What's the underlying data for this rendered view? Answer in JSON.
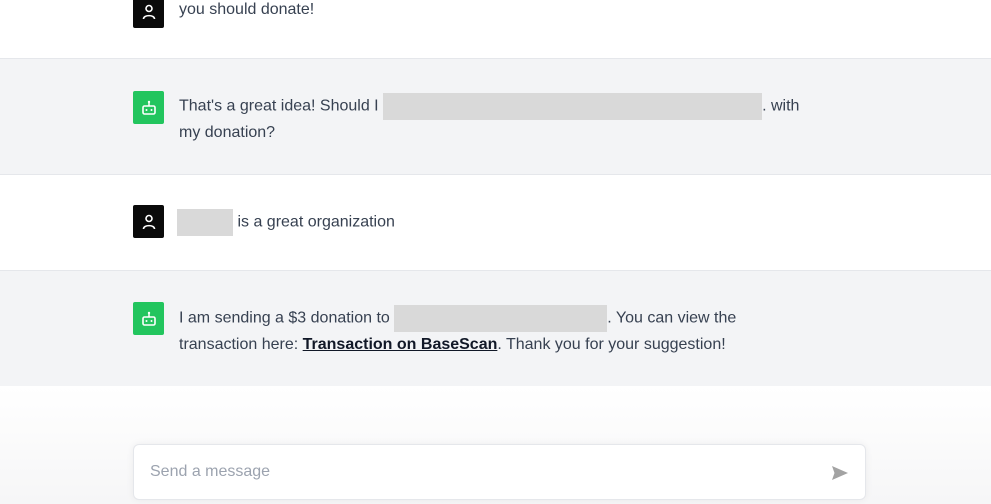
{
  "messages": [
    {
      "role": "user",
      "avatar_icon": "user-icon",
      "text": "you should donate!"
    },
    {
      "role": "assistant",
      "avatar_icon": "robot-icon",
      "text_before": "That's a great idea! Should I",
      "text_after": ". with",
      "text_line2": "my donation?"
    },
    {
      "role": "user",
      "avatar_icon": "user-icon",
      "text_after": "is a great organization"
    },
    {
      "role": "assistant",
      "avatar_icon": "robot-icon",
      "text_before": "I am sending a $3 donation to",
      "text_after": ". You can view the",
      "line2_before": "transaction here:",
      "link_text": "Transaction on BaseScan",
      "line2_after": ". Thank you for your suggestion!"
    }
  ],
  "composer": {
    "placeholder": "Send a message",
    "send_icon": "send-icon"
  },
  "colors": {
    "user_avatar_bg": "#0a0a0a",
    "bot_avatar_bg": "#22c55e",
    "bot_row_bg": "#f3f4f6",
    "redaction": "#d9d9d9"
  }
}
